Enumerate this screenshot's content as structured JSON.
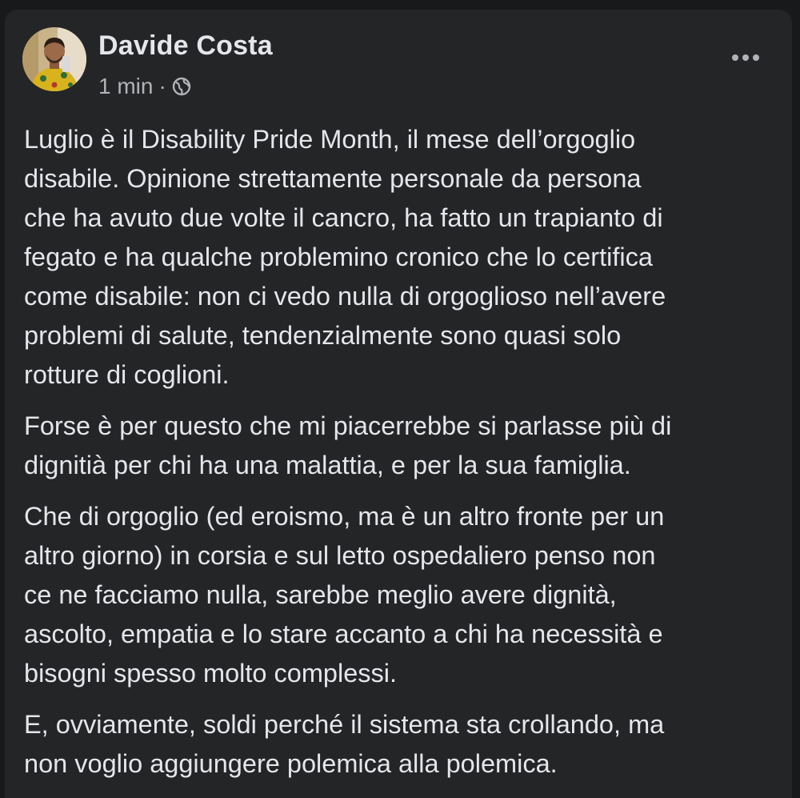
{
  "post": {
    "author": "Davide Costa",
    "time": "1 min",
    "separator": "·",
    "audience_icon": "globe-icon",
    "menu_icon": "more-horizontal-icon",
    "paragraphs": [
      [
        "Luglio è il Disability Pride Month, il mese dell’orgoglio",
        "disabile. Opinione strettamente personale da persona",
        "che ha avuto due volte il cancro, ha fatto un trapianto di",
        "fegato e ha qualche problemino cronico che lo certifica",
        "come disabile: non ci vedo nulla di orgoglioso nell’avere",
        "problemi di salute, tendenzialmente sono quasi solo",
        "rotture di coglioni."
      ],
      [
        "Forse è per questo che mi piacerrebbe si parlasse più di",
        "dignitià per chi ha una malattia, e per la sua famiglia."
      ],
      [
        "Che di orgoglio (ed eroismo, ma è un altro fronte per un",
        "altro giorno) in corsia e sul letto ospedaliero penso non",
        "ce ne facciamo nulla, sarebbe meglio avere dignità,",
        "ascolto, empatia e lo stare accanto a chi ha necessità e",
        "bisogni spesso molto complessi."
      ],
      [
        "E, ovviamente, soldi perché il sistema sta crollando, ma",
        "non voglio aggiungere polemica alla polemica."
      ]
    ]
  },
  "colors": {
    "background": "#18191a",
    "card": "#242526",
    "primary_text": "#e4e6eb",
    "secondary_text": "#b0b3b8"
  }
}
